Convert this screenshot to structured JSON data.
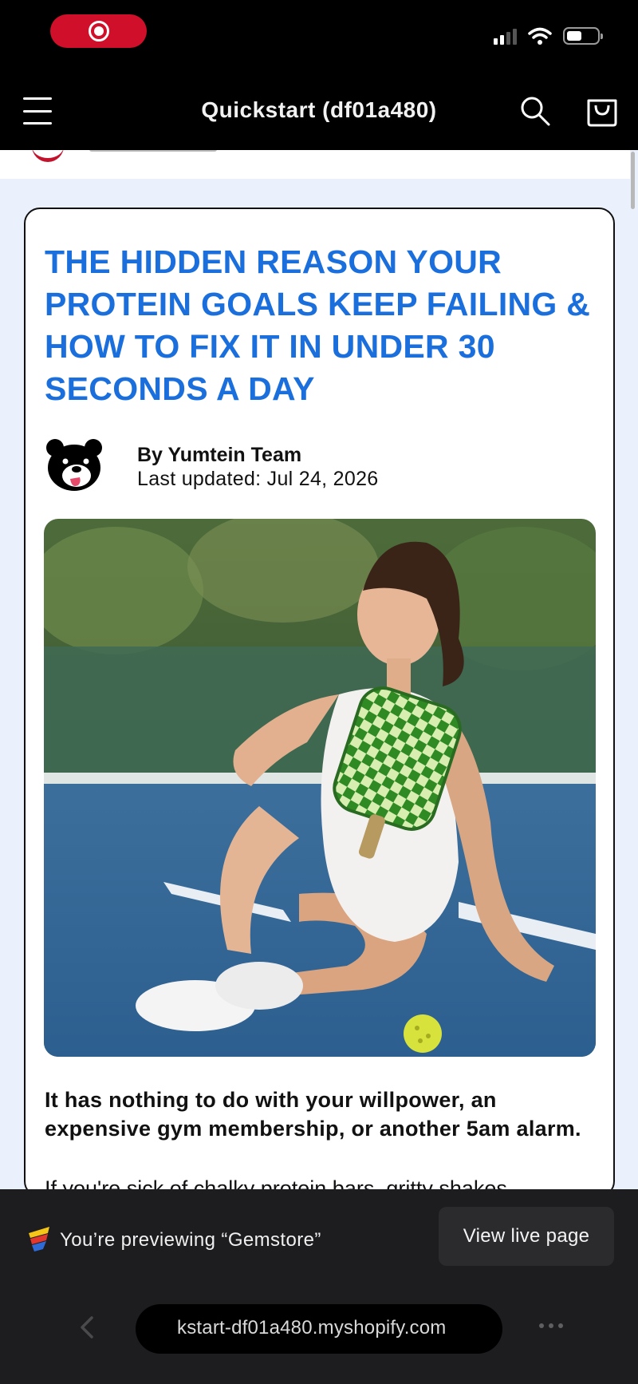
{
  "header": {
    "store_title": "Quickstart (df01a480)",
    "icons": [
      "menu-icon",
      "search-icon",
      "cart-icon"
    ]
  },
  "article": {
    "headline": "THE HIDDEN REASON YOUR PROTEIN GOALS KEEP FAILING & HOW TO FIX IT IN UNDER 30 SECONDS A DAY",
    "byline": "By Yumtein Team",
    "last_updated": "Last updated: Jul 24, 2026",
    "intro": "It has nothing to do with your willpower, an expensive gym membership, or another 5am alarm.",
    "next_paragraph_peek": "If you're sick of chalky protein bars, gritty shakes"
  },
  "preview_bar": {
    "preview_text": "You’re previewing “Gemstore”",
    "live_button": "View live page",
    "url": "kstart-df01a480.myshopify.com"
  },
  "colors": {
    "headline_blue": "#1a6fdc",
    "page_background": "#eaf1fd",
    "recording_red": "#d0102b",
    "preview_bar_bg": "#1d1c1e"
  }
}
